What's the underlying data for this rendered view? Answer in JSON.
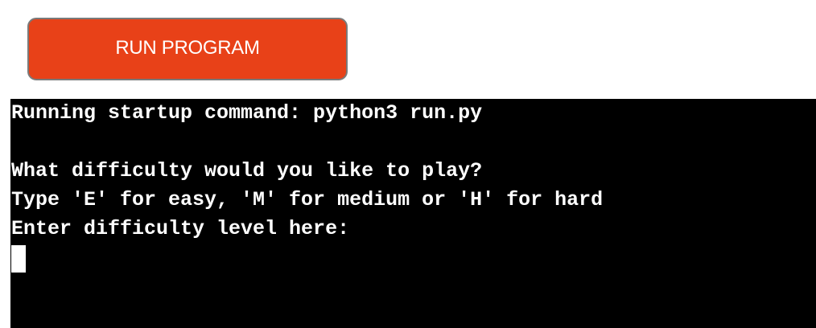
{
  "toolbar": {
    "run_label": "RUN PROGRAM",
    "run_button_color": "#e84118"
  },
  "terminal": {
    "background": "#000000",
    "foreground": "#ffffff",
    "lines": [
      "Running startup command: python3 run.py",
      "",
      "What difficulty would you like to play?",
      "Type 'E' for easy, 'M' for medium or 'H' for hard",
      "Enter difficulty level here:"
    ],
    "input_value": ""
  }
}
